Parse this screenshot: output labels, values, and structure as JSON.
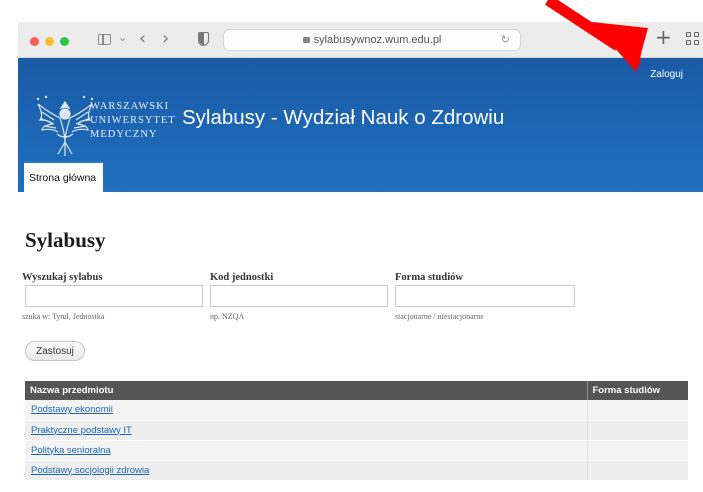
{
  "browser": {
    "url": "sylabusywnoz.wum.edu.pl"
  },
  "header": {
    "login_label": "Zaloguj",
    "university_lines": [
      "WARSZAWSKI",
      "UNIWERSYTET",
      "MEDYCZNY"
    ],
    "site_title": "Sylabusy - Wydział Nauk o Zdrowiu",
    "tab_home": "Strona główna",
    "brand_color": "#1c66b4"
  },
  "main": {
    "heading": "Sylabusy",
    "filters": [
      {
        "label": "Wyszukaj sylabus",
        "value": "",
        "hint": "szuka w: Tytuł, Jednostka"
      },
      {
        "label": "Kod jednostki",
        "value": "",
        "hint": "np. NZQA"
      },
      {
        "label": "Forma studiów",
        "value": "",
        "hint": "stacjonarne / niestacjonarne"
      }
    ],
    "apply_label": "Zastosuj"
  },
  "table": {
    "columns": [
      "Nazwa przedmiotu",
      "Forma studiów"
    ],
    "rows": [
      {
        "name": "Podstawy ekonomii",
        "form": ""
      },
      {
        "name": "Praktyczne podstawy IT",
        "form": ""
      },
      {
        "name": "Polityka senioralna",
        "form": ""
      },
      {
        "name": "Podstawy socjologii zdrowia",
        "form": ""
      }
    ]
  },
  "annotation": {
    "arrow_color": "#ff0000"
  }
}
